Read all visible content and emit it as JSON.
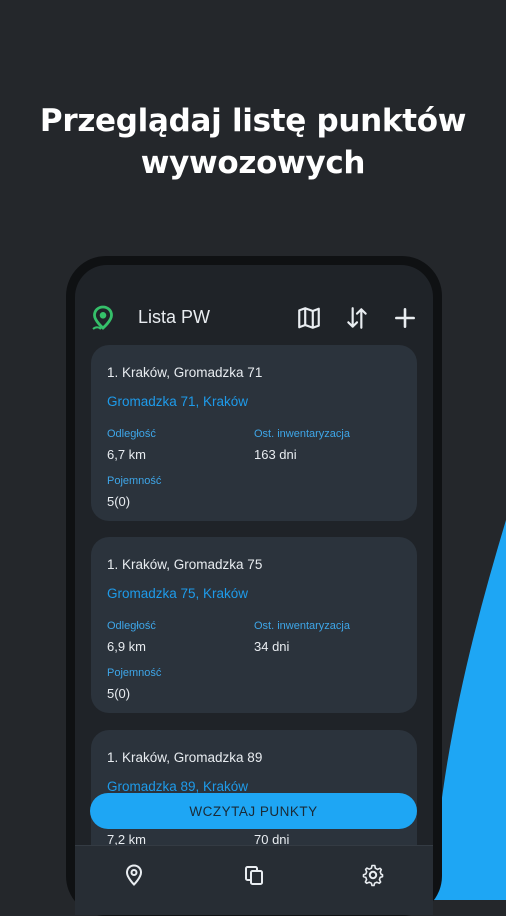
{
  "headline": {
    "line1": "Przeglądaj listę punktów",
    "line2": "wywozowych"
  },
  "colors": {
    "background": "#24272b",
    "accent_blue": "#1ea6f4",
    "logo_green": "#35c06a",
    "card": "#2b333c"
  },
  "appbar": {
    "logo_icon": "location-pin-icon",
    "title": "Lista PW",
    "actions": [
      "map-icon",
      "sort-icon",
      "add-icon"
    ]
  },
  "cards": [
    {
      "name": "1. Kraków, Gromadzka 71",
      "address": "Gromadzka 71, Kraków",
      "distance_label": "Odległość",
      "distance_value": "6,7 km",
      "inventory_label": "Ost. inwentaryzacja",
      "inventory_value": "163 dni",
      "capacity_label": "Pojemność",
      "capacity_value": "5(0)"
    },
    {
      "name": "1. Kraków, Gromadzka 75",
      "address": "Gromadzka 75, Kraków",
      "distance_label": "Odległość",
      "distance_value": "6,9 km",
      "inventory_label": "Ost. inwentaryzacja",
      "inventory_value": "34 dni",
      "capacity_label": "Pojemność",
      "capacity_value": "5(0)"
    },
    {
      "name": "1. Kraków, Gromadzka 89",
      "address": "Gromadzka 89, Kraków",
      "distance_value": "7,2 km",
      "inventory_value": "70 dni"
    }
  ],
  "load_button": "WCZYTAJ PUNKTY",
  "bottom_nav": [
    "location-pin-icon",
    "copy-icon",
    "settings-gear-icon"
  ]
}
